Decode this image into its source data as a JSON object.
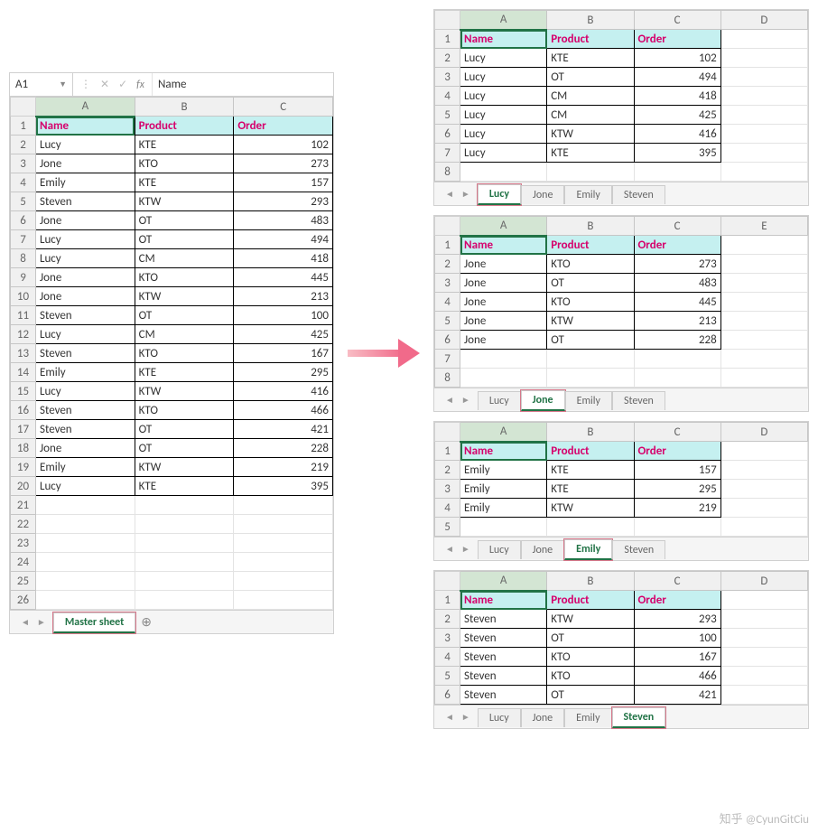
{
  "left": {
    "name_box": "A1",
    "fx_label": "fx",
    "formula_value": "Name",
    "columns": [
      "A",
      "B",
      "C"
    ],
    "header_row": [
      "Name",
      "Product",
      "Order"
    ],
    "rows": [
      [
        "Lucy",
        "KTE",
        "102"
      ],
      [
        "Jone",
        "KTO",
        "273"
      ],
      [
        "Emily",
        "KTE",
        "157"
      ],
      [
        "Steven",
        "KTW",
        "293"
      ],
      [
        "Jone",
        "OT",
        "483"
      ],
      [
        "Lucy",
        "OT",
        "494"
      ],
      [
        "Lucy",
        "CM",
        "418"
      ],
      [
        "Jone",
        "KTO",
        "445"
      ],
      [
        "Jone",
        "KTW",
        "213"
      ],
      [
        "Steven",
        "OT",
        "100"
      ],
      [
        "Lucy",
        "CM",
        "425"
      ],
      [
        "Steven",
        "KTO",
        "167"
      ],
      [
        "Emily",
        "KTE",
        "295"
      ],
      [
        "Lucy",
        "KTW",
        "416"
      ],
      [
        "Steven",
        "KTO",
        "466"
      ],
      [
        "Steven",
        "OT",
        "421"
      ],
      [
        "Jone",
        "OT",
        "228"
      ],
      [
        "Emily",
        "KTW",
        "219"
      ],
      [
        "Lucy",
        "KTE",
        "395"
      ]
    ],
    "empty_rows": [
      "21",
      "22",
      "23",
      "24",
      "25",
      "26"
    ],
    "tabs": [
      "Master sheet"
    ],
    "active_tab": 0,
    "highlighted_tab": 0
  },
  "right_panels": [
    {
      "columns": [
        "A",
        "B",
        "C",
        "D"
      ],
      "header_row": [
        "Name",
        "Product",
        "Order"
      ],
      "rows": [
        [
          "Lucy",
          "KTE",
          "102"
        ],
        [
          "Lucy",
          "OT",
          "494"
        ],
        [
          "Lucy",
          "CM",
          "418"
        ],
        [
          "Lucy",
          "CM",
          "425"
        ],
        [
          "Lucy",
          "KTW",
          "416"
        ],
        [
          "Lucy",
          "KTE",
          "395"
        ]
      ],
      "extra_blank": 1,
      "tabs": [
        "Lucy",
        "Jone",
        "Emily",
        "Steven"
      ],
      "active_tab": 0,
      "highlighted_tab": 0
    },
    {
      "columns": [
        "A",
        "B",
        "C",
        "E"
      ],
      "header_row": [
        "Name",
        "Product",
        "Order"
      ],
      "rows": [
        [
          "Jone",
          "KTO",
          "273"
        ],
        [
          "Jone",
          "OT",
          "483"
        ],
        [
          "Jone",
          "KTO",
          "445"
        ],
        [
          "Jone",
          "KTW",
          "213"
        ],
        [
          "Jone",
          "OT",
          "228"
        ]
      ],
      "extra_blank": 2,
      "tabs": [
        "Lucy",
        "Jone",
        "Emily",
        "Steven"
      ],
      "active_tab": 1,
      "highlighted_tab": 1
    },
    {
      "columns": [
        "A",
        "B",
        "C",
        "D"
      ],
      "header_row": [
        "Name",
        "Product",
        "Order"
      ],
      "rows": [
        [
          "Emily",
          "KTE",
          "157"
        ],
        [
          "Emily",
          "KTE",
          "295"
        ],
        [
          "Emily",
          "KTW",
          "219"
        ]
      ],
      "extra_blank": 1,
      "tabs": [
        "Lucy",
        "Jone",
        "Emily",
        "Steven"
      ],
      "active_tab": 2,
      "highlighted_tab": 2
    },
    {
      "columns": [
        "A",
        "B",
        "C",
        "D"
      ],
      "header_row": [
        "Name",
        "Product",
        "Order"
      ],
      "rows": [
        [
          "Steven",
          "KTW",
          "293"
        ],
        [
          "Steven",
          "OT",
          "100"
        ],
        [
          "Steven",
          "KTO",
          "167"
        ],
        [
          "Steven",
          "KTO",
          "466"
        ],
        [
          "Steven",
          "OT",
          "421"
        ]
      ],
      "extra_blank": 0,
      "tabs": [
        "Lucy",
        "Jone",
        "Emily",
        "Steven"
      ],
      "active_tab": 3,
      "highlighted_tab": 3
    }
  ],
  "watermark": "知乎 @CyunGitCiu"
}
